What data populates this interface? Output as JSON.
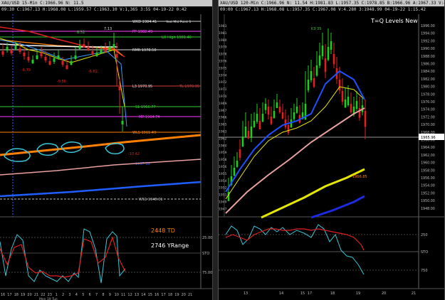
{
  "left": {
    "title": "XAU/USD 15-Min C:1966.96 N: 11.5",
    "quote": "09:30 C:1967.13 H:1968.08 L:1959.57 C:1963.10 V:1,365 3:55 04-19-22 0:42",
    "levels": {
      "wkd": "WKD 1984.41",
      "wkd_note": "Yest Mid Point 1",
      "pp": "PP 1982.49",
      "lh": "LH High 1981.46",
      "rmr": "RMR 1978.50",
      "l3": "L3 1970.95",
      "tl": "TL 1970.95",
      "s1": "S1 1966.77",
      "mp": "MP 1964.74",
      "wls": "WLS 1961.49",
      "ws1": "WS1 1948.01",
      "v1": "1957.39"
    },
    "bar_labels": [
      "7.13",
      "8.32",
      "-6.79",
      "-6.82",
      "-9.58",
      "-10.42"
    ],
    "td_text": "2448 TD",
    "yrange_text": "2746 YRange",
    "xaxis": [
      "16",
      "17",
      "18",
      "19",
      "20",
      "21",
      "22",
      "23",
      "1",
      "2",
      "3",
      "4",
      "5",
      "6",
      "7",
      "8",
      "9",
      "10",
      "11",
      "12",
      "13",
      "14",
      "15",
      "16",
      "17",
      "18",
      "19",
      "20",
      "21"
    ],
    "xaxis_day": "Mon 19 Tue"
  },
  "right": {
    "title": "XAU/USD 120-Min C:1966.96 N: 11.54 H:1981.83 L:1957.35 C:1978.85 B:1966.96 A:1967.33 V:47.4K",
    "quote": "09:00 C:1967.13 H:1968.08 L:1957.35 C:1967.08 V:4.280 3:1948.99 04-19-22 1:15.42",
    "watermark": "T=Q Levels New",
    "top_label": "K3 35",
    "current_price": "1965.96",
    "ma_label": "1966.85",
    "yaxis": [
      "1996.00",
      "1994.00",
      "1992.00",
      "1990.00",
      "1988.00",
      "1986.00",
      "1984.00",
      "1982.00",
      "1980.00",
      "1978.00",
      "1976.00",
      "1974.00",
      "1972.00",
      "1970.00",
      "1968.00",
      "1966.00",
      "1964.00",
      "1962.00",
      "1960.00",
      "1958.00",
      "1956.00",
      "1954.00",
      "1952.00",
      "1950.00",
      "1948.00"
    ],
    "left_axis": [
      "1983",
      "1981",
      "1980",
      "1979",
      "1978",
      "1976",
      "1975",
      "1974",
      "1972",
      "1971",
      "1970",
      "1969",
      "1967",
      "1966",
      "1965",
      "1963",
      "1962",
      "1960",
      "1959",
      "1958",
      "1956",
      "1955",
      "1954",
      "1952",
      "1951",
      "1949",
      "1947"
    ],
    "xaxis": [
      "13",
      "14",
      "15",
      "17",
      "18",
      "19",
      "20",
      "21"
    ],
    "osc_axis": [
      "250",
      "STO",
      "750"
    ]
  },
  "left_osc_axis": [
    "25.00",
    "STO",
    "75.00"
  ],
  "colors": {
    "up": "#22cc22",
    "down": "#e02020",
    "yellow": "#e6e600",
    "blue": "#1a2be0",
    "pink": "#e8a0a0",
    "cyan": "#39c6d6",
    "orange": "#ff8000",
    "white": "#ffffff",
    "magenta": "#ff33ff",
    "gray_level": "#888888"
  }
}
